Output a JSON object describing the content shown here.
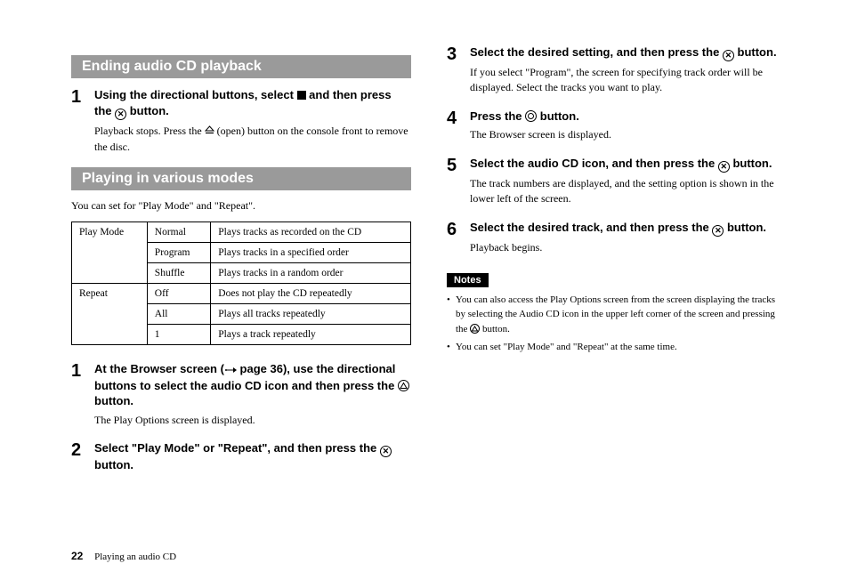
{
  "left": {
    "section1": {
      "header": "Ending audio CD playback",
      "step1": {
        "title_a": "Using the directional buttons, select ",
        "title_b": " and then press the ",
        "title_c": " button.",
        "text_a": "Playback stops. Press the ",
        "text_b": " (open) button on the console front to remove the disc."
      }
    },
    "section2": {
      "header": "Playing in various modes",
      "intro": "You can set for \"Play Mode\" and \"Repeat\".",
      "table": {
        "rows": [
          {
            "cat": "Play Mode",
            "mode": "Normal",
            "desc": "Plays tracks as recorded on the CD"
          },
          {
            "cat": "",
            "mode": "Program",
            "desc": "Plays tracks in a specified order"
          },
          {
            "cat": "",
            "mode": "Shuffle",
            "desc": "Plays tracks in a random order"
          },
          {
            "cat": "Repeat",
            "mode": "Off",
            "desc": "Does not play the CD repeatedly"
          },
          {
            "cat": "",
            "mode": "All",
            "desc": "Plays all tracks repeatedly"
          },
          {
            "cat": "",
            "mode": "1",
            "desc": "Plays a track repeatedly"
          }
        ]
      },
      "step1": {
        "title_a": "At the Browser screen (",
        "title_b": " page 36), use the directional buttons to select the audio CD icon and then press the ",
        "title_c": " button.",
        "text": "The Play Options screen is displayed."
      },
      "step2": {
        "title_a": "Select \"Play Mode\" or \"Repeat\", and then press the ",
        "title_b": " button."
      }
    }
  },
  "right": {
    "step3": {
      "title_a": "Select the desired setting, and then press the ",
      "title_b": " button.",
      "text": "If you select \"Program\", the screen for specifying track order will be displayed. Select the tracks you want to play."
    },
    "step4": {
      "title_a": "Press the ",
      "title_b": " button.",
      "text": "The Browser screen is displayed."
    },
    "step5": {
      "title_a": "Select the audio CD icon, and then press the ",
      "title_b": " button.",
      "text": "The track numbers are displayed, and the setting option is shown in the lower left of the screen."
    },
    "step6": {
      "title_a": "Select the desired track, and then press the ",
      "title_b": " button.",
      "text": "Playback begins."
    },
    "notes_label": "Notes",
    "notes": {
      "n1a": "You can also access the Play Options screen from the screen displaying the tracks by selecting the Audio CD icon in the upper left corner of the screen and pressing the ",
      "n1b": " button.",
      "n2": "You can set \"Play Mode\" and \"Repeat\" at the same time."
    }
  },
  "footer": {
    "page": "22",
    "title": "Playing an audio CD"
  }
}
